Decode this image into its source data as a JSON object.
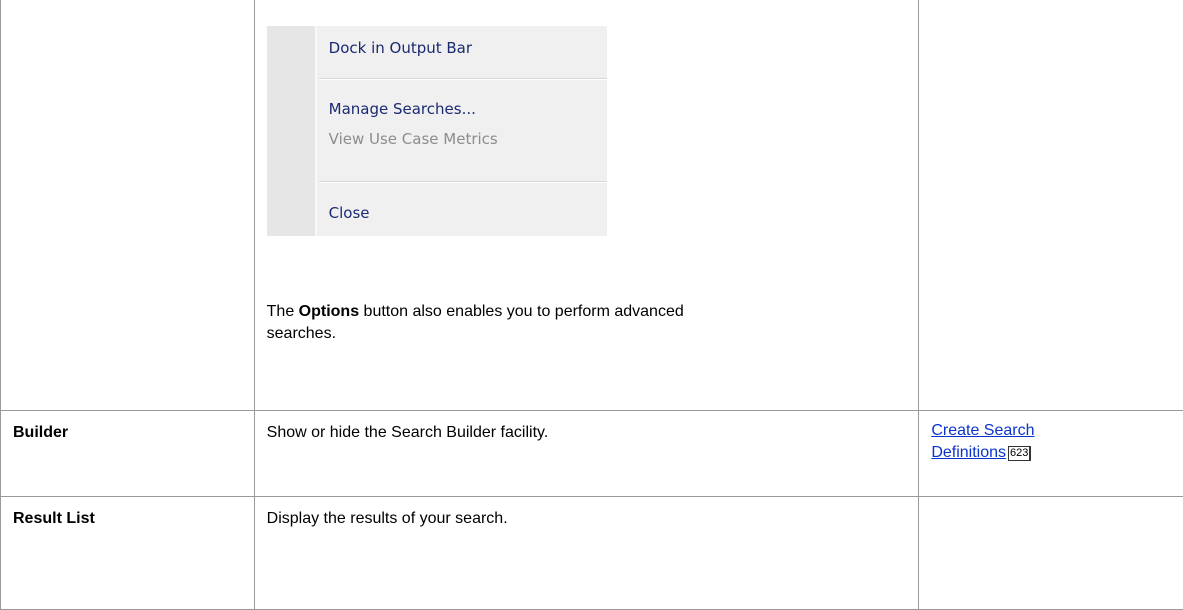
{
  "menu": {
    "items": [
      {
        "label": "Dock in Output Bar",
        "enabled": true
      },
      {
        "label": "Manage Searches...",
        "enabled": true
      },
      {
        "label": "View Use Case Metrics",
        "enabled": false
      },
      {
        "label": "Close",
        "enabled": true
      }
    ]
  },
  "options_text": {
    "prefix": "The ",
    "bold": "Options",
    "suffix": " button also enables you to perform advanced",
    "line2": "searches."
  },
  "rows": [
    {
      "option": "Builder",
      "action": "Show or hide the Search Builder facility.",
      "see_also": {
        "line1": "Create Search",
        "line2": "Definitions",
        "page": "623"
      }
    },
    {
      "option": "Result List",
      "action": "Display the results of your search."
    }
  ]
}
